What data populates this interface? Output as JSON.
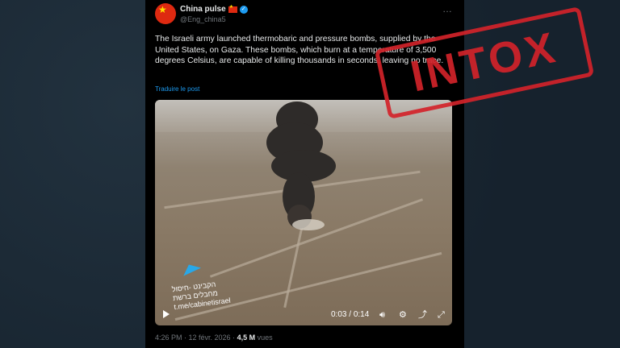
{
  "tweet": {
    "display_name": "China pulse",
    "handle": "@Eng_china5",
    "text": "The Israeli army launched thermobaric and pressure bombs, supplied by the United States, on Gaza. These bombs, which burn at a temperature of 3,500 degrees Celsius, are capable of killing thousands in seconds, leaving no trace.",
    "translate_link": "Traduire le post",
    "more_icon": "…",
    "timestamp": "4:26 PM · 12 févr. 2026 ·",
    "views_count": "4,5 M",
    "views_label": "vues"
  },
  "video": {
    "watermark_line1": "הקבינט -חיסול",
    "watermark_line2": "מחבלים ברשת",
    "watermark_line3": "t.me/cabinetisrael",
    "current_time": "0:03",
    "separator": "/",
    "duration": "0:14",
    "progress_fraction": 0.21
  },
  "stamp": {
    "text": "INTOX",
    "color": "#d2232a"
  },
  "icons": [
    "verified-badge-icon",
    "china-flag-icon",
    "more-icon",
    "play-icon",
    "volume-icon",
    "settings-icon",
    "share-icon",
    "fullscreen-icon",
    "telegram-icon"
  ]
}
